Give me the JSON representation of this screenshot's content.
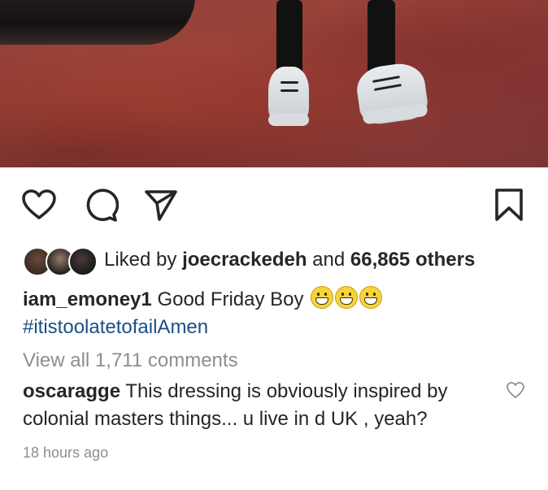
{
  "post": {
    "photo_alt": "photo",
    "likes": {
      "prefix": "Liked by",
      "user": "joecrackedeh",
      "and": "and",
      "count": "66,865 others"
    },
    "caption": {
      "user": "iam_emoney1",
      "text": "Good Friday Boy",
      "hashtag": "#itistoolatetofailAmen"
    },
    "view_all_comments": "View all 1,711 comments",
    "comment": {
      "user": "oscaragge",
      "text": "This dressing is obviously inspired by colonial masters things... u live in d UK , yeah?"
    },
    "timestamp": "18 hours ago"
  },
  "icons": {
    "like": "heart-icon",
    "comment": "comment-bubble-icon",
    "share": "send-icon",
    "save": "bookmark-icon",
    "comment_like": "small-heart-icon"
  },
  "colors": {
    "text": "#262626",
    "muted": "#8e8e8e",
    "hashtag": "#1b4f86",
    "background": "#ffffff"
  }
}
